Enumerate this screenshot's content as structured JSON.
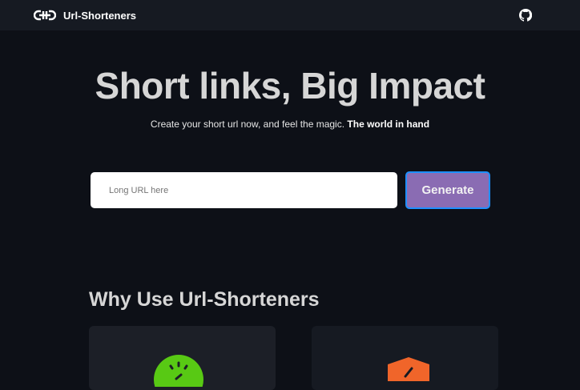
{
  "nav": {
    "brand": "Url-Shorteners",
    "logo_icon": "chain-link-logo",
    "github_icon": "github-icon"
  },
  "hero": {
    "title": "Short links, Big Impact",
    "subtitle": "Create your short url now, and feel the magic.",
    "subtitle_bold": "The world in hand"
  },
  "form": {
    "placeholder": "Long URL here",
    "button": "Generate"
  },
  "features": {
    "title": "Why Use Url-Shorteners",
    "cards": [
      {
        "icon": "speedometer-icon",
        "color": "#58c914"
      },
      {
        "icon": "shield-check-icon",
        "color": "#f0652a"
      }
    ]
  },
  "colors": {
    "button": "#8a6cb3",
    "button_border": "#1e90ff"
  }
}
